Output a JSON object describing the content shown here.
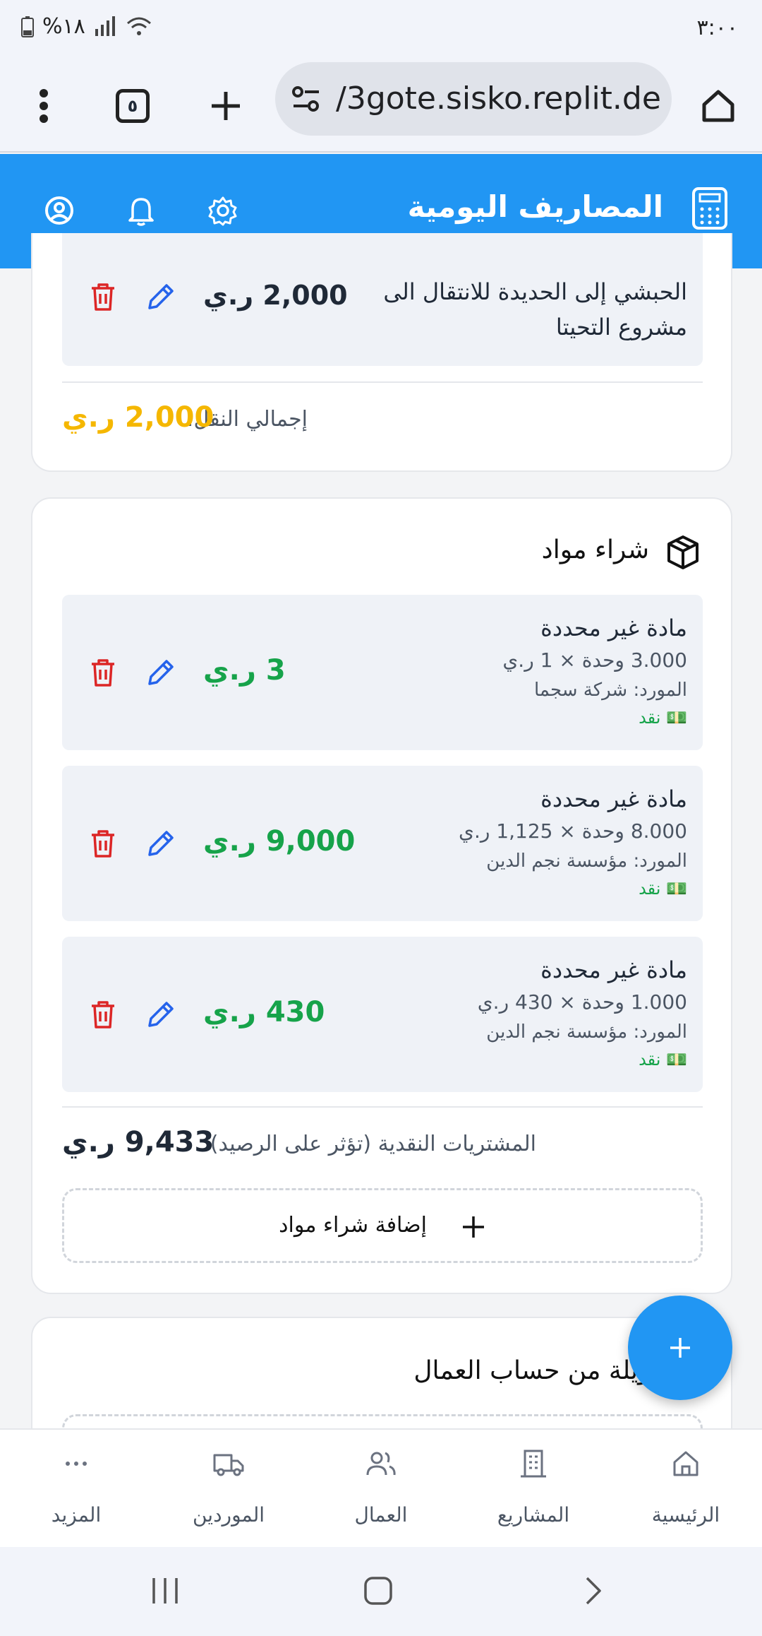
{
  "status_bar": {
    "time": "٣:٠٠",
    "battery": "%١٨"
  },
  "browser": {
    "url": "/3gote.sisko.replit.dev",
    "tab_count": "٥"
  },
  "app_bar": {
    "title": "المصاريف اليومية"
  },
  "transport_card": {
    "item_text_lines": [
      "الحبشي إلى الحديدة للانتقال الى",
      "مشروع التحيتا"
    ],
    "item_amount": "2,000 ر.ي",
    "total_label": "إجمالي النقل:",
    "total_value": "2,000 ر.ي"
  },
  "materials_card": {
    "title": "شراء مواد",
    "items": [
      {
        "name": "مادة غير محددة",
        "qty": "3.000 وحدة × 1 ر.ي",
        "supplier": "المورد: شركة سجما",
        "payment": "💵 نقد",
        "amount": "3 ر.ي"
      },
      {
        "name": "مادة غير محددة",
        "qty": "8.000 وحدة × 1,125 ر.ي",
        "supplier": "المورد: مؤسسة نجم الدين",
        "payment": "💵 نقد",
        "amount": "9,000 ر.ي"
      },
      {
        "name": "مادة غير محددة",
        "qty": "1.000 وحدة × 430 ر.ي",
        "supplier": "المورد: مؤسسة نجم الدين",
        "payment": "💵 نقد",
        "amount": "430 ر.ي"
      }
    ],
    "total_label": "المشتريات النقدية (تؤثر على الرصيد):",
    "total_value": "9,433 ر.ي",
    "add_button": "إضافة شراء مواد"
  },
  "workers_card": {
    "title": "تحويلة من حساب العمال"
  },
  "bottom_nav": [
    {
      "label": "الرئيسية",
      "icon": "home-icon"
    },
    {
      "label": "المشاريع",
      "icon": "building-icon"
    },
    {
      "label": "العمال",
      "icon": "users-icon"
    },
    {
      "label": "الموردين",
      "icon": "truck-icon"
    },
    {
      "label": "المزيد",
      "icon": "more-icon"
    }
  ],
  "colors": {
    "primary": "#2196f3",
    "green": "#16a34a",
    "red": "#dc2626",
    "yellow": "#f5b700"
  }
}
